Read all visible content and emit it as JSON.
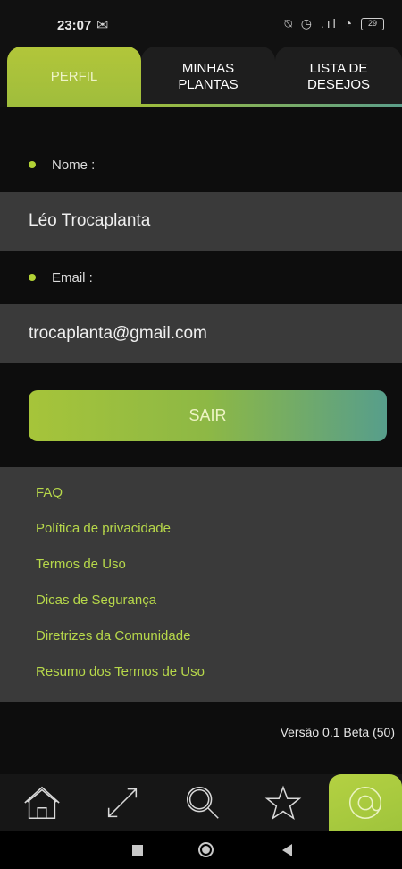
{
  "status_bar": {
    "time": "23:07",
    "battery": "29",
    "right_icons": "⍉ ◷ .ıl"
  },
  "tabs": [
    {
      "label": "PERFIL",
      "active": true
    },
    {
      "label": "MINHAS PLANTAS",
      "active": false
    },
    {
      "label": "LISTA DE DESEJOS",
      "active": false
    }
  ],
  "profile": {
    "name_label": "Nome :",
    "name_value": "Léo Trocaplanta",
    "email_label": "Email :",
    "email_value": "trocaplanta@gmail.com"
  },
  "logout_button": "SAIR",
  "links": [
    "FAQ",
    "Política de privacidade",
    "Termos de Uso",
    "Dicas de Segurança",
    "Diretrizes da Comunidade",
    "Resumo dos Termos de Uso"
  ],
  "version": "Versão 0.1 Beta (50)",
  "bottom_nav": [
    {
      "icon": "home-icon",
      "active": false
    },
    {
      "icon": "trade-arrows-icon",
      "active": false
    },
    {
      "icon": "search-icon",
      "active": false
    },
    {
      "icon": "star-icon",
      "active": false
    },
    {
      "icon": "at-sign-icon",
      "active": true
    }
  ],
  "colors": {
    "accent_green": "#b2d235",
    "teal": "#579e8b",
    "panel_gray": "#3a3a3a",
    "background": "#0d0d0d"
  }
}
